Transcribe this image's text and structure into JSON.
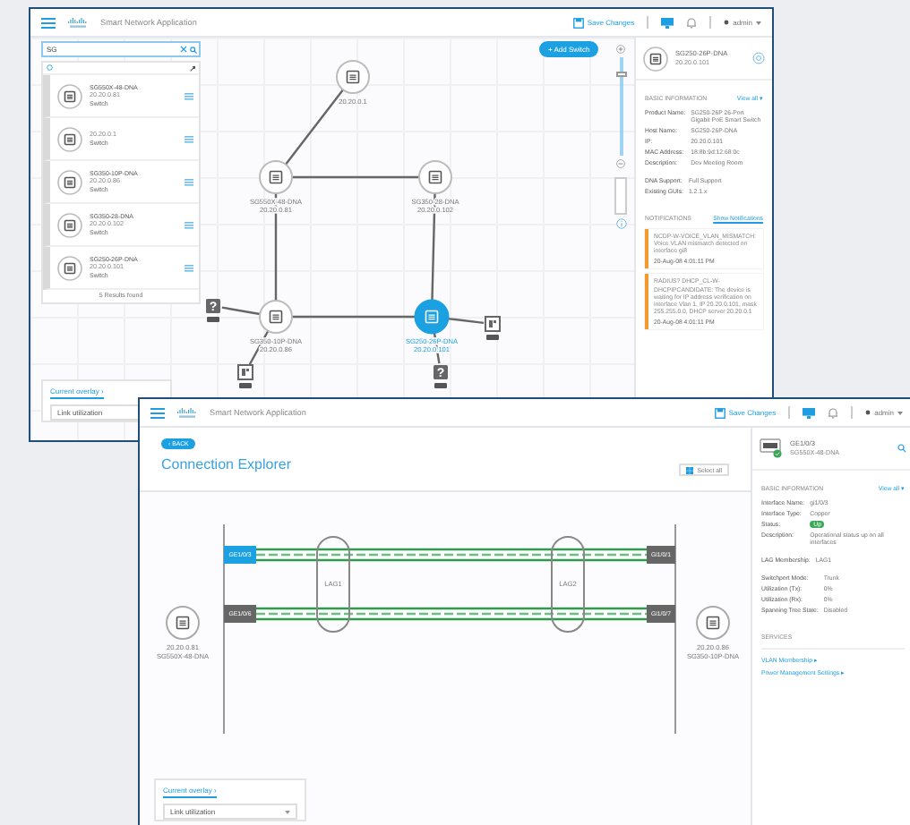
{
  "desktop": {
    "topology_window": {
      "header": {
        "title": "Smart Network Application",
        "save_label": "Save Changes",
        "user": "admin"
      },
      "search": {
        "value": "SG"
      },
      "results": [
        {
          "name": "SG550X-48-DNA",
          "ip": "20.20.0.81",
          "type": "Switch"
        },
        {
          "ip": "20.20.0.1",
          "type": "Switch"
        },
        {
          "name": "SG350-10P-DNA",
          "ip": "20.20.0.86",
          "type": "Switch"
        },
        {
          "name": "SG350-28-DNA",
          "ip": "20.20.0.102",
          "type": "Switch"
        },
        {
          "name": "SG250-26P-DNA",
          "ip": "20.20.0.101",
          "type": "Switch"
        }
      ],
      "results_count": "5 Results found",
      "add_button": "+ Add Switch",
      "zoom": {
        "level": 0.85
      },
      "nodes": [
        {
          "kind": "switch",
          "ip": "20.20.0.1",
          "selected": false
        },
        {
          "kind": "switch",
          "name": "SG550X-48-DNA",
          "ip": "20.20.0.81",
          "selected": false
        },
        {
          "kind": "switch",
          "name": "SG350-28-DNA",
          "ip": "20.20.0.102",
          "selected": false
        },
        {
          "kind": "switch",
          "name": "SG350-10P-DNA",
          "ip": "20.20.0.86",
          "selected": false
        },
        {
          "kind": "switch",
          "name": "SG250-26P-DNA",
          "ip": "20.20.0.101",
          "selected": true
        },
        {
          "kind": "unknown",
          "symbol": "?",
          "selected": false
        },
        {
          "kind": "endpoint",
          "selected": false
        },
        {
          "kind": "unknown",
          "symbol": "?",
          "selected": false
        },
        {
          "kind": "endpoint",
          "selected": false
        }
      ],
      "device": {
        "name": "SG250-26P-DNA",
        "ip": "20.20.0.101"
      },
      "basic_information": {
        "heading": "BASIC INFORMATION",
        "link": "View all ▾",
        "field_groups": [
          [
            {
              "kind": "text",
              "label": "Product Name:",
              "value": "SG250-26P 26-Port Gigabit PoE Smart Switch"
            },
            {
              "kind": "text",
              "label": "Host Name:",
              "value": "SG250-26P-DNA"
            },
            {
              "kind": "text",
              "label": "IP:",
              "value": "20.20.0.101"
            },
            {
              "kind": "text",
              "label": "MAC Address:",
              "value": "18:8b:9d:12:68:0c"
            },
            {
              "kind": "text",
              "label": "Description:",
              "value": "Dev Meeting Room"
            }
          ],
          [
            {
              "kind": "text",
              "label": "DNA Support:",
              "value": "Full Support"
            },
            {
              "kind": "text",
              "label": "Existing GUIs:",
              "value": "1.2.1.x"
            }
          ]
        ]
      },
      "notifications": {
        "heading": "NOTIFICATIONS",
        "link": "Show Notifications",
        "items": [
          {
            "text": "NCDP-W-VOICE_VLAN_MISMATCH: Voice VLAN mismatch detected on interface gi8",
            "time": "20-Aug-08 4:01:11 PM"
          },
          {
            "text": "RADIUS? DHCP_CL-W-DHCPIPCANDIDATE: The device is waiting for IP address verification on interface Vlan 1, IP 20.20.0.101, mask 255.255.0.0, DHCP server 20.20.0.1",
            "time": "20-Aug-08 4:01:11 PM"
          }
        ]
      },
      "overlay": {
        "label": "Current overlay ›",
        "value": "Link utilization"
      }
    },
    "explorer_window": {
      "header": {
        "title": "Smart Network Application",
        "save_label": "Save Changes",
        "user": "admin"
      },
      "back_button": "‹ BACK",
      "title": "Connection Explorer",
      "select_all": "Select all",
      "left_device": {
        "ip": "20.20.0.81",
        "name": "SG550X-48-DNA"
      },
      "right_device": {
        "ip": "20.20.0.86",
        "name": "SG350-10P-DNA"
      },
      "connections": [
        {
          "left_port": "GE1/0/3",
          "right_port": "Gi1/0/1",
          "selected": true
        },
        {
          "left_port": "GE1/0/6",
          "right_port": "Gi1/0/7",
          "selected": false
        }
      ],
      "lags": [
        "LAG1",
        "LAG2"
      ],
      "interface": {
        "name": "GE1/0/3",
        "device": "SG550X-48-DNA"
      },
      "basic_information": {
        "heading": "BASIC INFORMATION",
        "link": "View all ▾",
        "field_groups": [
          [
            {
              "kind": "text",
              "label": "Interface Name:",
              "value": "gi1/0/3"
            },
            {
              "kind": "text",
              "label": "Interface Type:",
              "value": "Copper"
            },
            {
              "kind": "badge",
              "label": "Status:",
              "value": "Up"
            },
            {
              "kind": "text",
              "label": "Description:",
              "value": "Operational status up on all interfaces"
            }
          ],
          [
            {
              "kind": "text",
              "label": "LAG Membership:",
              "value": "LAG1"
            }
          ],
          [
            {
              "kind": "text",
              "label": "Switchport Mode:",
              "value": "Trunk"
            },
            {
              "kind": "text",
              "label": "Utilization (Tx):",
              "value": "0%"
            },
            {
              "kind": "text",
              "label": "Utilization (Rx):",
              "value": "0%"
            },
            {
              "kind": "text",
              "label": "Spanning Tree State:",
              "value": "Disabled"
            }
          ]
        ]
      },
      "services": {
        "heading": "SERVICES",
        "links": [
          "VLAN Membership ▸",
          "Power Management Settings ▸"
        ]
      },
      "overlay": {
        "label": "Current overlay ›",
        "value": "Link utilization"
      }
    }
  }
}
